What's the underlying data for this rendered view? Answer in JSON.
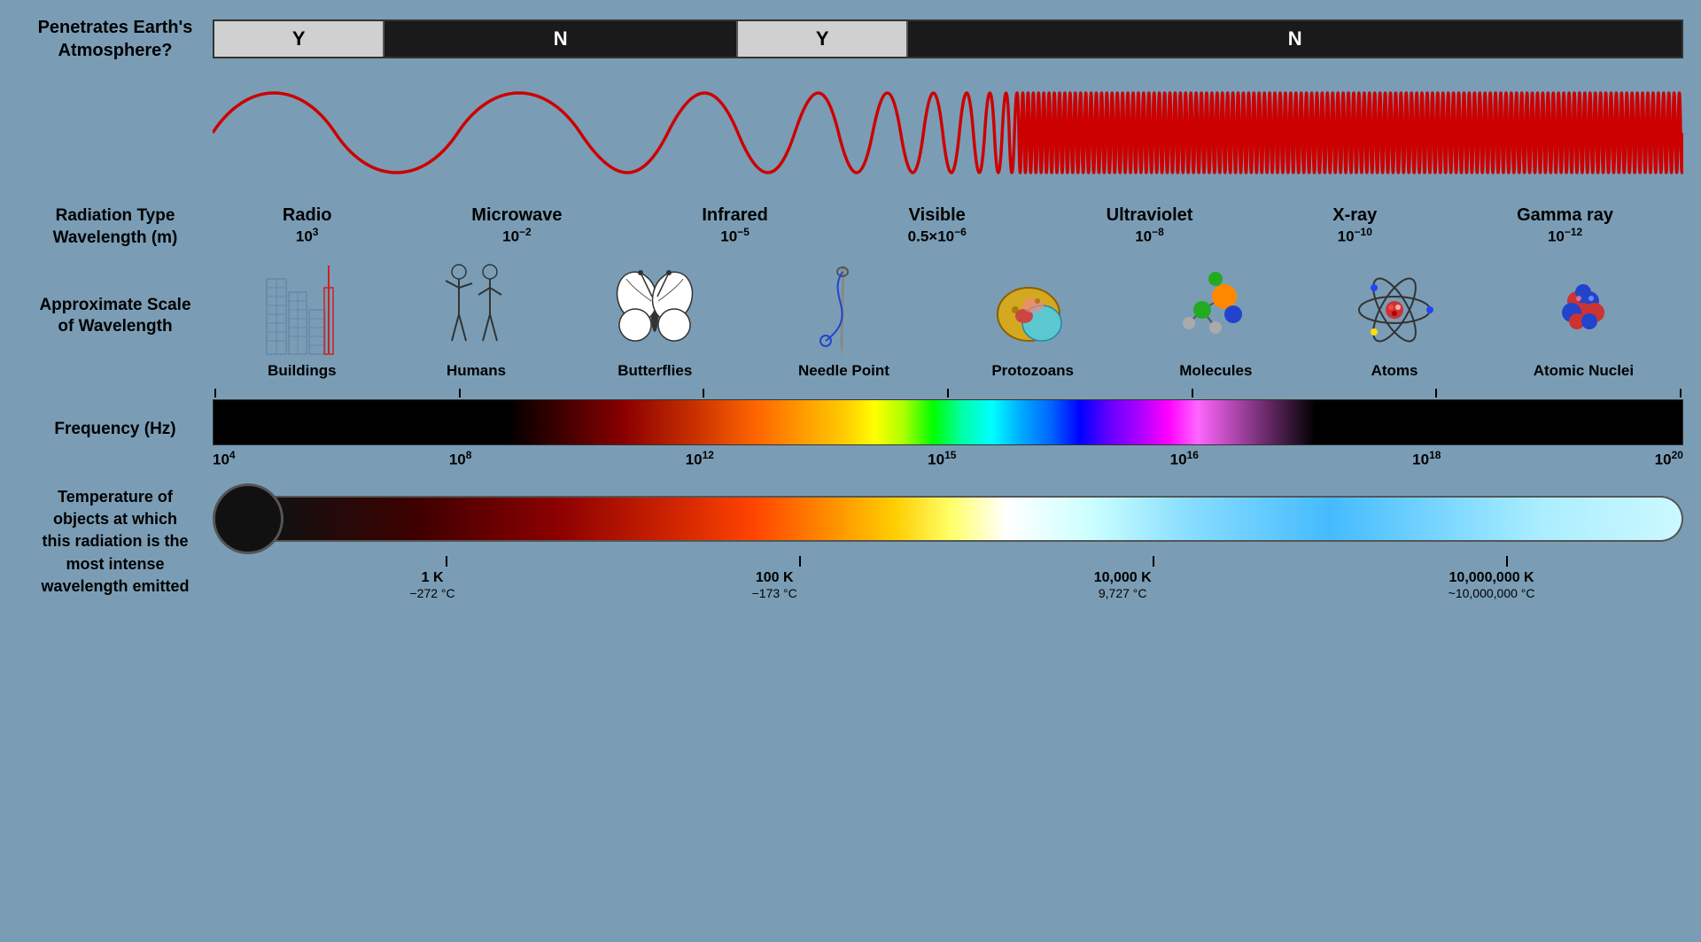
{
  "atmosphere": {
    "label_line1": "Penetrates Earth's",
    "label_line2": "Atmosphere?",
    "segments": [
      {
        "label": "Y",
        "class": "atm-y1"
      },
      {
        "label": "N",
        "class": "atm-n1"
      },
      {
        "label": "Y",
        "class": "atm-y2"
      },
      {
        "label": "N",
        "class": "atm-n2"
      }
    ]
  },
  "radiation": {
    "label_line1": "Radiation Type",
    "label_line2": "Wavelength (m)",
    "types": [
      {
        "name": "Radio",
        "wavelength": "10",
        "exp": "3"
      },
      {
        "name": "Microwave",
        "wavelength": "10",
        "exp": "-2"
      },
      {
        "name": "Infrared",
        "wavelength": "10",
        "exp": "-5"
      },
      {
        "name": "Visible",
        "wavelength": "0.5×10",
        "exp": "-6"
      },
      {
        "name": "Ultraviolet",
        "wavelength": "10",
        "exp": "-8"
      },
      {
        "name": "X-ray",
        "wavelength": "10",
        "exp": "-10"
      },
      {
        "name": "Gamma ray",
        "wavelength": "10",
        "exp": "-12"
      }
    ]
  },
  "scale": {
    "label_line1": "Approximate Scale",
    "label_line2": "of Wavelength",
    "items": [
      {
        "name": "Buildings"
      },
      {
        "name": "Humans"
      },
      {
        "name": "Butterflies"
      },
      {
        "name": "Needle Point"
      },
      {
        "name": "Protozoans"
      },
      {
        "name": "Molecules"
      },
      {
        "name": "Atoms"
      },
      {
        "name": "Atomic Nuclei"
      }
    ]
  },
  "frequency": {
    "label": "Frequency (Hz)",
    "values": [
      "10⁴",
      "10⁸",
      "10¹²",
      "10¹⁵",
      "10¹⁶",
      "10¹⁸",
      "10²⁰"
    ]
  },
  "temperature": {
    "label_line1": "Temperature of",
    "label_line2": "objects at which",
    "label_line3": "this radiation is the",
    "label_line4": "most intense",
    "label_line5": "wavelength emitted",
    "ticks": [
      {
        "val": "1 K",
        "sub": "−272 °C"
      },
      {
        "val": "100 K",
        "sub": "−173 °C"
      },
      {
        "val": "10,000 K",
        "sub": "9,727 °C"
      },
      {
        "val": "10,000,000 K",
        "sub": "~10,000,000 °C"
      }
    ]
  }
}
